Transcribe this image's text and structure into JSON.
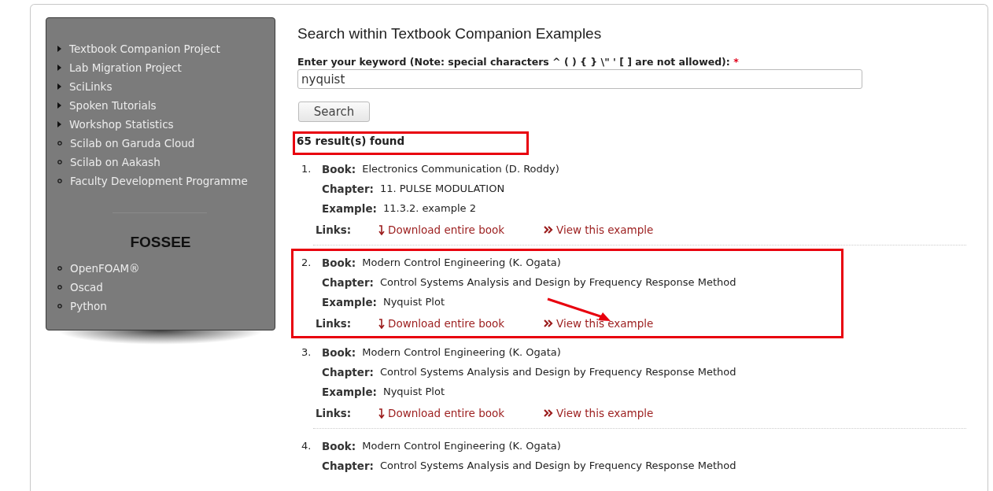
{
  "sidebar": {
    "items": [
      {
        "text": "Textbook Companion Project",
        "kind": "triangle"
      },
      {
        "text": "Lab Migration Project",
        "kind": "triangle"
      },
      {
        "text": "SciLinks",
        "kind": "triangle"
      },
      {
        "text": "Spoken Tutorials",
        "kind": "triangle"
      },
      {
        "text": "Workshop Statistics",
        "kind": "triangle"
      },
      {
        "text": "Scilab on Garuda Cloud",
        "kind": "circle"
      },
      {
        "text": "Scilab on Aakash",
        "kind": "circle"
      },
      {
        "text": "Faculty Development Programme",
        "kind": "circle"
      }
    ],
    "section_title": "FOSSEE",
    "section_items": [
      {
        "text": "OpenFOAM®",
        "kind": "circle"
      },
      {
        "text": "Oscad",
        "kind": "circle"
      },
      {
        "text": "Python",
        "kind": "circle"
      }
    ]
  },
  "search": {
    "title": "Search within Textbook Companion Examples",
    "label": "Enter your keyword (Note: special characters ^ ( ) { } \\\" ' [ ] are not allowed):",
    "required_mark": "*",
    "value": "nyquist",
    "button": "Search"
  },
  "results_count": {
    "text": "65 result(s) found",
    "highlighted": true
  },
  "results": [
    {
      "number": "1.",
      "highlighted": false,
      "pointer": false,
      "fields": [
        {
          "label": "Book:",
          "value": "Electronics Communication (D. Roddy)"
        },
        {
          "label": "Chapter:",
          "value": "11. PULSE MODULATION"
        },
        {
          "label": "Example:",
          "value": "11.3.2. example 2"
        }
      ],
      "links_label": "Links:",
      "links": [
        {
          "kind": "download",
          "text": "Download entire book"
        },
        {
          "kind": "view",
          "text": "View this example"
        }
      ]
    },
    {
      "number": "2.",
      "highlighted": true,
      "pointer": true,
      "fields": [
        {
          "label": "Book:",
          "value": "Modern Control Engineering (K. Ogata)"
        },
        {
          "label": "Chapter:",
          "value": "Control Systems Analysis and Design by Frequency Response Method"
        },
        {
          "label": "Example:",
          "value": "Nyquist Plot"
        }
      ],
      "links_label": "Links:",
      "links": [
        {
          "kind": "download",
          "text": "Download entire book"
        },
        {
          "kind": "view",
          "text": "View this example"
        }
      ]
    },
    {
      "number": "3.",
      "highlighted": false,
      "pointer": false,
      "fields": [
        {
          "label": "Book:",
          "value": "Modern Control Engineering (K. Ogata)"
        },
        {
          "label": "Chapter:",
          "value": "Control Systems Analysis and Design by Frequency Response Method"
        },
        {
          "label": "Example:",
          "value": "Nyquist Plot"
        }
      ],
      "links_label": "Links:",
      "links": [
        {
          "kind": "download",
          "text": "Download entire book"
        },
        {
          "kind": "view",
          "text": "View this example"
        }
      ]
    },
    {
      "number": "4.",
      "highlighted": false,
      "pointer": false,
      "fields": [
        {
          "label": "Book:",
          "value": "Modern Control Engineering (K. Ogata)"
        },
        {
          "label": "Chapter:",
          "value": "Control Systems Analysis and Design by Frequency Response Method"
        }
      ]
    }
  ]
}
